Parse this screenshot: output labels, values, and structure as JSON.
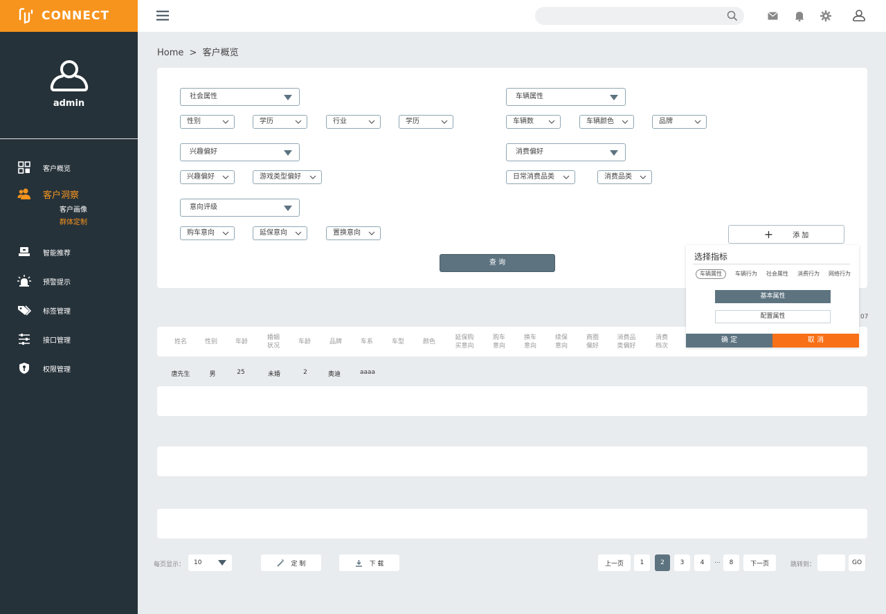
{
  "app": {
    "logo_text": "CONNECT",
    "accent": "#f7941d"
  },
  "profile": {
    "name": "admin"
  },
  "sidebar": {
    "items": [
      {
        "label": "客户概览",
        "icon": "grid-icon"
      },
      {
        "label": "客户洞察",
        "icon": "users-icon",
        "active": true
      },
      {
        "label": "智能推荐",
        "icon": "recommend-icon"
      },
      {
        "label": "预警提示",
        "icon": "alarm-icon"
      },
      {
        "label": "标签管理",
        "icon": "tag-icon"
      },
      {
        "label": "接口管理",
        "icon": "sliders-icon"
      },
      {
        "label": "权限管理",
        "icon": "key-shield-icon"
      }
    ],
    "subitems": [
      {
        "label": "客户画像"
      },
      {
        "label": "群体定制",
        "active": true
      }
    ]
  },
  "header": {
    "search_placeholder": ""
  },
  "breadcrumb": {
    "home": "Home",
    "sep": ">",
    "current": "客户概览"
  },
  "filters": {
    "social": "社会属性",
    "vehicle": "车辆属性",
    "interest": "兴趣偏好",
    "consume": "消费偏好",
    "intent": "意向评级",
    "social_opts": [
      "性别",
      "学历",
      "行业",
      "学历"
    ],
    "vehicle_opts": [
      "车辆数",
      "车辆颜色",
      "品牌"
    ],
    "interest_opts": [
      "兴趣偏好",
      "游戏类型偏好"
    ],
    "consume_opts": [
      "日常消费品类",
      "消费品类"
    ],
    "intent_opts": [
      "购车意向",
      "延保意向",
      "置换意向"
    ],
    "query": "查 询",
    "add": "添 加"
  },
  "popup": {
    "title": "选择指标",
    "tabs": [
      "车辆属性",
      "车辆行为",
      "社会属性",
      "消费行为",
      "网络行为"
    ],
    "basic": "基本属性",
    "config": "配置属性",
    "ok": "确 定",
    "cancel": "取 消"
  },
  "table": {
    "headers": [
      "姓名",
      "性别",
      "年龄",
      "婚姻\n状况",
      "车龄",
      "品牌",
      "车系",
      "车型",
      "颜色",
      "延保购\n买意向",
      "购车\n意向",
      "换车\n意向",
      "续保\n意向",
      "商圈\n偏好",
      "消费品\n类偏好",
      "消费\n档次"
    ],
    "rows": [
      [
        "唐先生",
        "男",
        "25",
        "未婚",
        "2",
        "奥迪",
        "aaaa"
      ]
    ],
    "count_fragment": "07"
  },
  "footer": {
    "per_page_label": "每页显示：",
    "per_page_value": "10",
    "custom": "定 制",
    "download": "下 载",
    "prev": "上一页",
    "pages": [
      "1",
      "2",
      "3",
      "4",
      "8"
    ],
    "current_page": "2",
    "ellipsis": "...",
    "next": "下一页",
    "jump_label": "跳转到：",
    "go": "GO"
  }
}
